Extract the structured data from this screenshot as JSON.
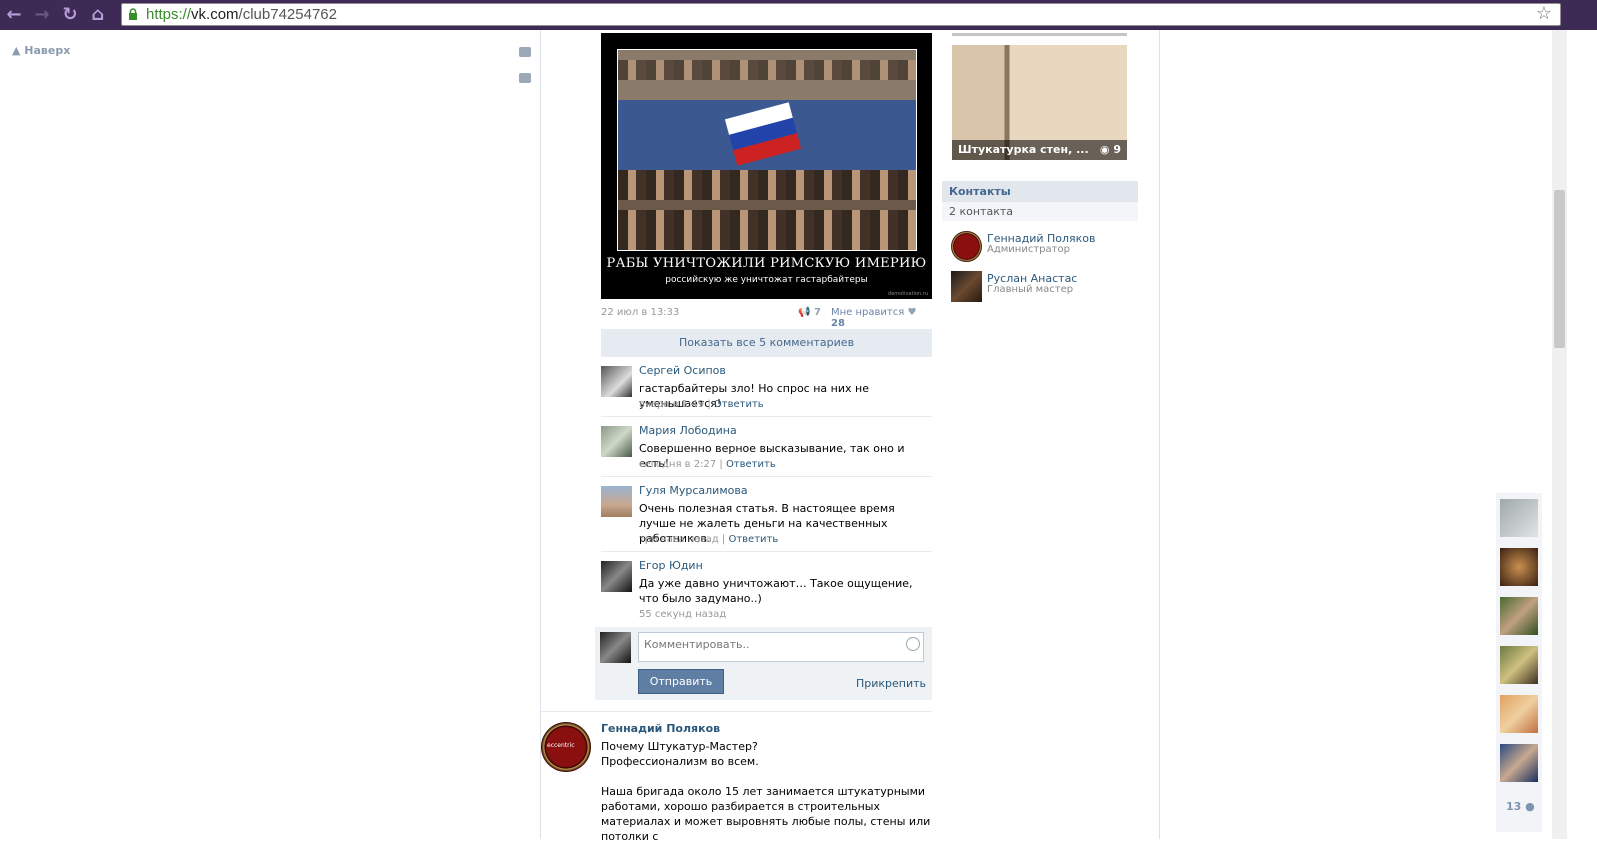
{
  "browser": {
    "url_scheme": "https://",
    "url_host": "vk.com",
    "url_path": "/club74254762"
  },
  "left": {
    "to_top": "Наверх"
  },
  "post": {
    "image": {
      "title": "РАБЫ УНИЧТОЖИЛИ РИМСКУЮ ИМЕРИЮ",
      "subtitle": "российскую же уничтожат гастарбайтеры",
      "watermark": "demotivation.ru"
    },
    "date": "22 июл в 13:33",
    "reposts": "7",
    "like_label": "Мне нравится",
    "likes": "28",
    "show_all_comments": "Показать все 5 комментариев",
    "comments": [
      {
        "author": "Сергей Осипов",
        "text": "гастарбайтеры зло! Но спрос на них не уменьшается!",
        "time": "вчера в 1:49",
        "reply": "Ответить"
      },
      {
        "author": "Мария Лободина",
        "text": "Совершенно верное высказывание, так оно и есть!",
        "time": "сегодня в 2:27",
        "reply": "Ответить"
      },
      {
        "author": "Гуля Мурсалимова",
        "text": "Очень полезная статья. В настоящее время лучше не жалеть деньги на качественных работников.",
        "time": "три часа назад",
        "reply": "Ответить"
      },
      {
        "author": "Егор Юдин",
        "text": "Да уже давно уничтожают… Такое ощущение, что было задумано..)",
        "time": "55 секунд назад",
        "reply": ""
      }
    ],
    "comment_placeholder": "Комментировать..",
    "send_label": "Отправить",
    "attach_label": "Прикрепить"
  },
  "next_post": {
    "author": "Геннадий Поляков",
    "avatar_text": "eccentric",
    "text": "Почему Штукатур-Мастер?\nПрофессионализм во всем.\n\nНаша бригада около 15 лет занимается штукатурными работами, хорошо разбирается в строительных материалах и может выровнять любые полы, стены или потолки с"
  },
  "sidebar": {
    "album_title": "Штукатурка стен, ...",
    "album_count": "9",
    "contacts_header": "Контакты",
    "contacts_count": "2 контакта",
    "contacts": [
      {
        "name": "Геннадий Поляков",
        "role": "Администратор"
      },
      {
        "name": "Руслан Анастас",
        "role": "Главный мастер"
      }
    ]
  },
  "friends_panel": {
    "count": "13"
  },
  "colors": {
    "link": "#2b587a",
    "button": "#5f7ea4",
    "chrome": "#3d2b56"
  }
}
